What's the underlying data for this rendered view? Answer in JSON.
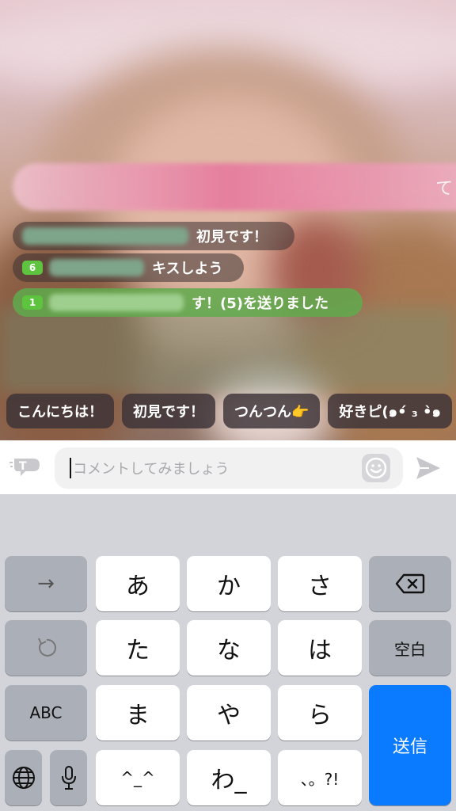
{
  "live": {
    "banner_text": "て",
    "comments": [
      {
        "level": "",
        "text": "初見です！"
      },
      {
        "level": "6",
        "text": "キスしよう"
      },
      {
        "level": "1",
        "text": "す！(5)を送りました"
      }
    ]
  },
  "quick_phrases": [
    "こんにちは！",
    "初見です！",
    "つんつん👉",
    "好きピ(๑•́ ₃ •̀๑"
  ],
  "comment_bar": {
    "placeholder": "コメントしてみましょう",
    "icons": [
      "translate-t-icon",
      "emoji-smile-icon",
      "send-paper-plane-icon"
    ]
  },
  "keyboard": {
    "row1": {
      "left": "→",
      "keys": [
        "あ",
        "か",
        "さ"
      ],
      "right_icon": "backspace-icon"
    },
    "row2": {
      "left_icon": "undo-icon",
      "keys": [
        "た",
        "な",
        "は"
      ],
      "right": "空白"
    },
    "row3": {
      "left": "ABC",
      "keys": [
        "ま",
        "や",
        "ら"
      ],
      "right": "送信"
    },
    "row4": {
      "left_icons": [
        "globe-icon",
        "microphone-icon"
      ],
      "keys": [
        "^_^",
        "わ_",
        "、。?!"
      ]
    }
  },
  "colors": {
    "send_key": "#0a7bff",
    "level_badge": "#5ec43f"
  }
}
